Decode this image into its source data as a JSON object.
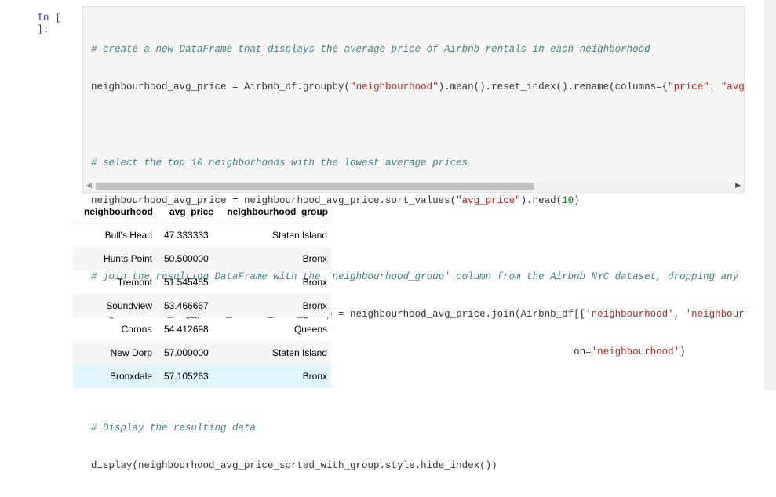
{
  "prompt": "In [ ]:",
  "code": {
    "line1": "# create a new DataFrame that displays the average price of Airbnb rentals in each neighborhood",
    "line2_a": "neighbourhood_avg_price = Airbnb_df.groupby(",
    "line2_s1": "\"neighbourhood\"",
    "line2_b": ").mean().reset_index().rename(columns={",
    "line2_s2": "\"price\"",
    "line2_c": ": ",
    "line2_s3": "\"avg_price",
    "line3": "# select the top 10 neighborhoods with the lowest average prices",
    "line4_a": "neighbourhood_avg_price = neighbourhood_avg_price.sort_values(",
    "line4_s1": "\"avg_price\"",
    "line4_b": ").head(",
    "line4_n": "10",
    "line4_c": ")",
    "line5": "# join the resulting DataFrame with the 'neighbourhood_group' column from the Airbnb NYC dataset, dropping any duplic",
    "line6_a": "neighbourhood_avg_price_sorted_with_group = neighbourhood_avg_price.join(Airbnb_df[[",
    "line6_s1": "'neighbourhood'",
    "line6_b": ", ",
    "line6_s2": "'neighbourhood_g",
    "line7_a": "                                                                                  on=",
    "line7_s1": "'neighbourhood'",
    "line7_b": ")",
    "line8": "# Display the resulting data",
    "line9": "display(neighbourhood_avg_price_sorted_with_group.style.hide_index())"
  },
  "table": {
    "headers": [
      "neighbourhood",
      "avg_price",
      "neighbourhood_group"
    ],
    "rows": [
      [
        "Bull's Head",
        "47.333333",
        "Staten Island"
      ],
      [
        "Hunts Point",
        "50.500000",
        "Bronx"
      ],
      [
        "Tremont",
        "51.545455",
        "Bronx"
      ],
      [
        "Soundview",
        "53.466667",
        "Bronx"
      ],
      [
        "Corona",
        "54.412698",
        "Queens"
      ],
      [
        "New Dorp",
        "57.000000",
        "Staten Island"
      ],
      [
        "Bronxdale",
        "57.105263",
        "Bronx"
      ]
    ]
  },
  "icons": {
    "scroll_left": "triangle-left",
    "scroll_right": "triangle-right"
  }
}
